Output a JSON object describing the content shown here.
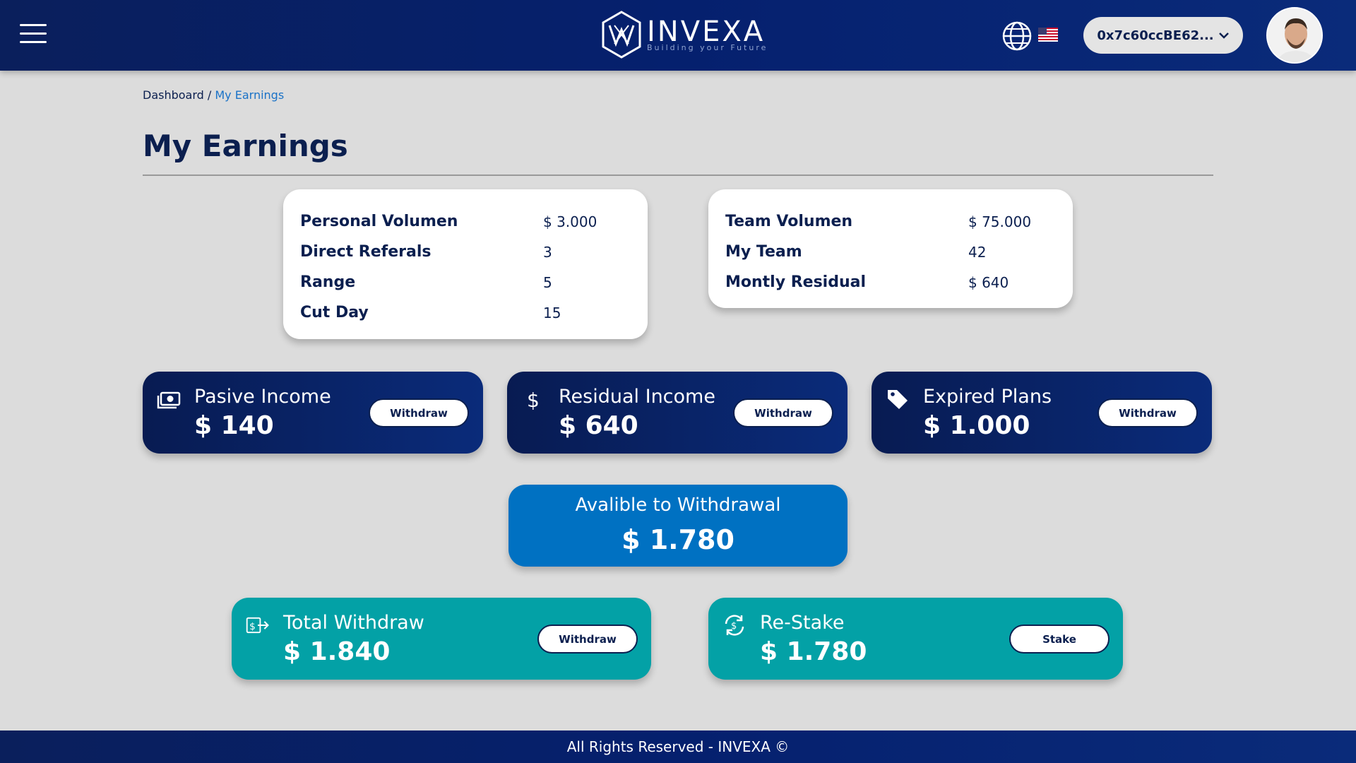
{
  "header": {
    "brand_name": "INVEXA",
    "brand_tagline": "Building your Future",
    "wallet_address": "0x7c60ccBE62...",
    "menu_icon": "hamburger-icon",
    "language_icon": "globe-icon",
    "flag_icon": "us-flag-icon"
  },
  "breadcrumb": {
    "root": "Dashboard",
    "separator": " / ",
    "current": "My Earnings"
  },
  "page": {
    "title": "My Earnings"
  },
  "personal_stats": [
    {
      "label": "Personal Volumen",
      "value": "$ 3.000"
    },
    {
      "label": "Direct Referals",
      "value": "3"
    },
    {
      "label": "Range",
      "value": "5"
    },
    {
      "label": "Cut Day",
      "value": "15"
    }
  ],
  "team_stats": [
    {
      "label": "Team Volumen",
      "value": "$ 75.000"
    },
    {
      "label": "My Team",
      "value": "42"
    },
    {
      "label": "Montly Residual",
      "value": "$ 640"
    }
  ],
  "income_cards": [
    {
      "title": "Pasive Income",
      "amount": "$ 140",
      "button": "Withdraw",
      "icon": "money-icon"
    },
    {
      "title": "Residual Income",
      "amount": "$ 640",
      "button": "Withdraw",
      "icon": "dollar-icon"
    },
    {
      "title": "Expired Plans",
      "amount": "$ 1.000",
      "button": "Withdraw",
      "icon": "tag-icon"
    }
  ],
  "available": {
    "title": "Avalible to Withdrawal",
    "amount": "$ 1.780"
  },
  "bottom_cards": [
    {
      "title": "Total Withdraw",
      "amount": "$ 1.840",
      "button": "Withdraw",
      "icon": "money-transfer-icon"
    },
    {
      "title": "Re-Stake",
      "amount": "$ 1.780",
      "button": "Stake",
      "icon": "restake-cycle-icon"
    }
  ],
  "footer": {
    "text": "All Rights Reserved - INVEXA ©"
  },
  "colors": {
    "navy": "#0a1f5c",
    "blue": "#0071c2",
    "teal": "#03a1a6",
    "background": "#dcdcdc"
  }
}
